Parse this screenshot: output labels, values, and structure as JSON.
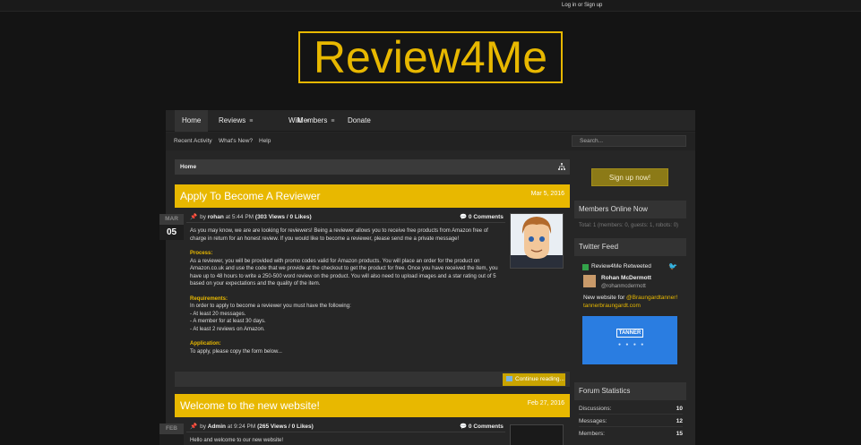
{
  "topbar": {
    "login_label": "Log in or Sign up"
  },
  "logo": {
    "text": "Review4Me",
    "color": "#e8b800"
  },
  "nav": {
    "items": [
      {
        "label": "Home"
      },
      {
        "label": "Reviews"
      },
      {
        "label": "Wiki"
      },
      {
        "label": "Members"
      },
      {
        "label": "Donate"
      }
    ]
  },
  "subnav": {
    "items": [
      {
        "label": "Recent Activity"
      },
      {
        "label": "What's New?"
      },
      {
        "label": "Help"
      }
    ],
    "search_placeholder": "Search..."
  },
  "breadcrumb": {
    "label": "Home",
    "icon": "sitemap-icon"
  },
  "posts": [
    {
      "title": "Apply To Become A Reviewer",
      "date": "Mar 5, 2016",
      "month": "MAR",
      "day": "05",
      "author": "rohan",
      "time": "5:44 PM",
      "stats": "(303 Views / 0 Likes)",
      "comments": "0 Comments",
      "intro": "As you may know, we are are looking for reviewers! Being a reviewer allows you to receive free products from Amazon free of charge in return for an honest review. If you would like to become a reviewer, please send me a private message!",
      "process_heading": "Process:",
      "process_text": "As a reviewer, you will be provided with promo codes valid for Amazon products. You will place an order for the product on Amazon.co.uk and use the code that we provide at the checkout to get the product for free. Once you have received the item, you have up to 48 hours to write a 250-500 word review on the product. You will also need to upload images and a star rating out of 5 based on your expectations and the quality of the item.",
      "req_heading": "Requirements:",
      "req_intro": "In order to apply to become a reviewer you must have the following:",
      "req_items": [
        "- At least 20 messages.",
        "- A member for at least 30 days.",
        "- At least 2 reviews on Amazon."
      ],
      "app_heading": "Application:",
      "app_text": "To apply, please copy the form below...",
      "continue_label": "Continue reading..."
    },
    {
      "title": "Welcome to the new website!",
      "date": "Feb 27, 2016",
      "month": "FEB",
      "author": "Admin",
      "time": "9:24 PM",
      "stats": "(265 Views / 0 Likes)",
      "comments": "0 Comments",
      "intro": "Hello and welcome to our new website!"
    }
  ],
  "sidebar": {
    "signup_label": "Sign up now!",
    "members_online": {
      "heading": "Members Online Now",
      "text": "Total: 1 (members: 0, guests: 1, robots: 0)"
    },
    "twitter": {
      "heading": "Twitter Feed",
      "retweet_label": "Review4Me Retweeted",
      "name": "Rohan McDermott",
      "handle": "@rohanmcdermott",
      "text_prefix": "New website for ",
      "mention": "@Braungardtanner!",
      "link": "tannerbraungardt.com",
      "card_name": "TANNER",
      "card_dots": "● ● ● ●",
      "card_color": "#2a7de1"
    },
    "forum_stats": {
      "heading": "Forum Statistics",
      "rows": [
        {
          "label": "Discussions:",
          "value": "10"
        },
        {
          "label": "Messages:",
          "value": "12"
        },
        {
          "label": "Members:",
          "value": "15"
        }
      ]
    }
  },
  "colors": {
    "accent": "#e8b800",
    "background": "#141414",
    "panel": "#262626"
  }
}
